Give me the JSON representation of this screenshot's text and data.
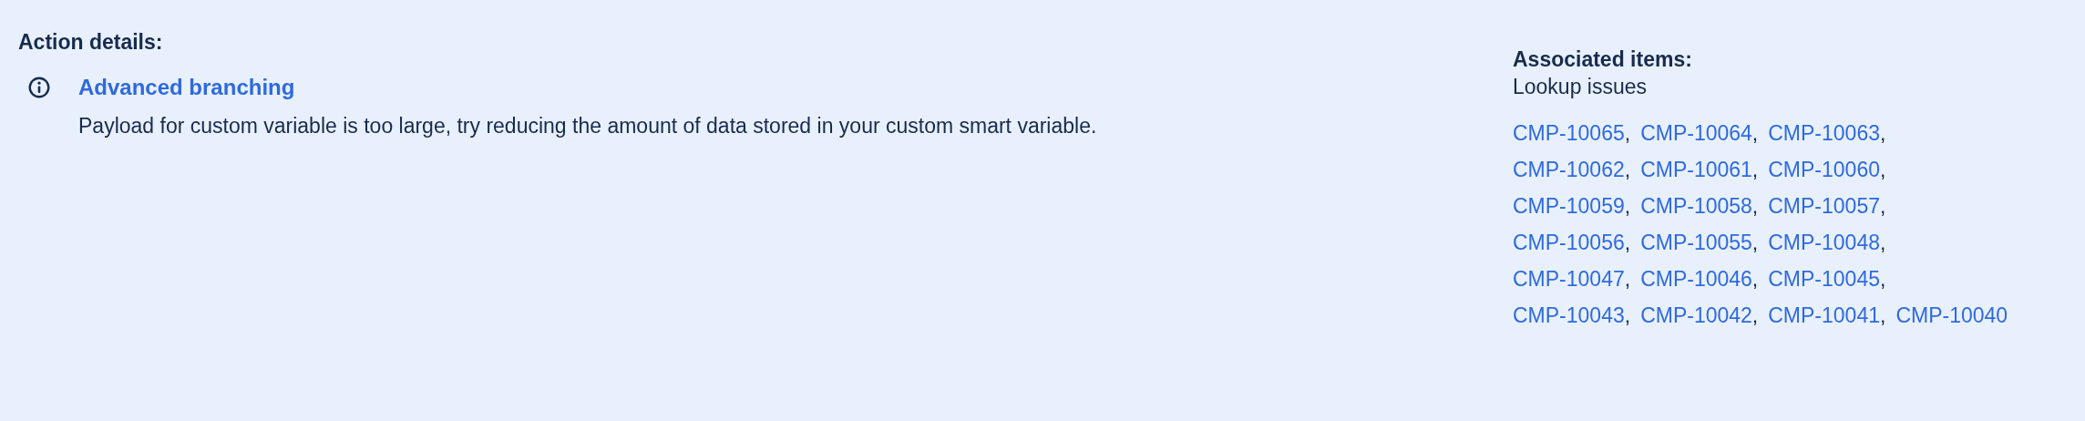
{
  "action_details": {
    "heading": "Action details:",
    "items": [
      {
        "kind": "info",
        "title": "Advanced branching",
        "message": "Payload for custom variable is too large, try reducing the amount of data stored in your custom smart variable."
      }
    ]
  },
  "associated_items": {
    "heading": "Associated items:",
    "subheading": "Lookup issues",
    "links": [
      {
        "label": "CMP-10065",
        "separator": ","
      },
      {
        "label": "CMP-10064",
        "separator": ","
      },
      {
        "label": "CMP-10063",
        "separator": ","
      },
      {
        "label": "CMP-10062",
        "separator": ","
      },
      {
        "label": "CMP-10061",
        "separator": ","
      },
      {
        "label": "CMP-10060",
        "separator": ","
      },
      {
        "label": "CMP-10059",
        "separator": ","
      },
      {
        "label": "CMP-10058",
        "separator": ","
      },
      {
        "label": "CMP-10057",
        "separator": ","
      },
      {
        "label": "CMP-10056",
        "separator": ","
      },
      {
        "label": "CMP-10055",
        "separator": ","
      },
      {
        "label": "CMP-10048",
        "separator": ","
      },
      {
        "label": "CMP-10047",
        "separator": ","
      },
      {
        "label": "CMP-10046",
        "separator": ","
      },
      {
        "label": "CMP-10045",
        "separator": ","
      },
      {
        "label": "CMP-10043",
        "separator": ","
      },
      {
        "label": "CMP-10042",
        "separator": ","
      },
      {
        "label": "CMP-10041",
        "separator": ","
      },
      {
        "label": "CMP-10040"
      }
    ]
  }
}
